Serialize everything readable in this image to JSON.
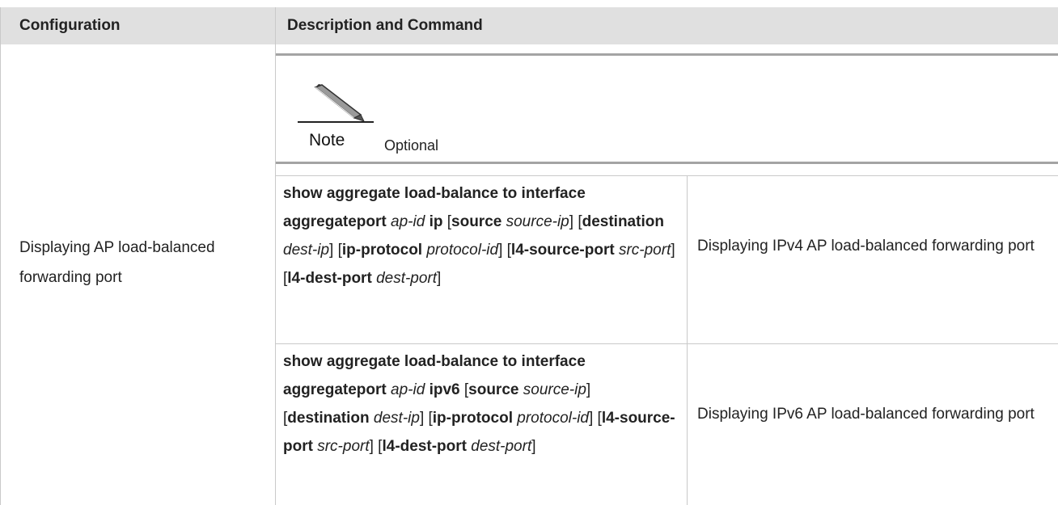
{
  "table": {
    "headers": {
      "configuration": "Configuration",
      "description": "Description and Command"
    },
    "row": {
      "configuration": "Displaying AP load-balanced forwarding port",
      "note": {
        "label": "Note",
        "text": "Optional",
        "icon": "pencil-icon"
      },
      "commands": [
        {
          "segments": [
            {
              "t": "show aggregate load-balance to interface aggregateport",
              "s": "b"
            },
            {
              "t": " ",
              "s": "n"
            },
            {
              "t": "ap-id",
              "s": "i"
            },
            {
              "t": " ",
              "s": "n"
            },
            {
              "t": "ip",
              "s": "b"
            },
            {
              "t": " [",
              "s": "n"
            },
            {
              "t": "source",
              "s": "b"
            },
            {
              "t": " ",
              "s": "n"
            },
            {
              "t": "source-ip",
              "s": "i"
            },
            {
              "t": "] [",
              "s": "n"
            },
            {
              "t": "destination",
              "s": "b"
            },
            {
              "t": " ",
              "s": "n"
            },
            {
              "t": "dest-ip",
              "s": "i"
            },
            {
              "t": "] [",
              "s": "n"
            },
            {
              "t": "ip-protocol",
              "s": "b"
            },
            {
              "t": " ",
              "s": "n"
            },
            {
              "t": "protocol-id",
              "s": "i"
            },
            {
              "t": "] [",
              "s": "n"
            },
            {
              "t": "l4-source-port",
              "s": "b"
            },
            {
              "t": " ",
              "s": "n"
            },
            {
              "t": "src-port",
              "s": "i"
            },
            {
              "t": "] [",
              "s": "n"
            },
            {
              "t": "l4-dest-port",
              "s": "b"
            },
            {
              "t": " ",
              "s": "n"
            },
            {
              "t": "dest-port",
              "s": "i"
            },
            {
              "t": "]",
              "s": "n"
            }
          ],
          "description": "Displaying IPv4 AP load-balanced forwarding port"
        },
        {
          "segments": [
            {
              "t": "show aggregate load-balance to interface aggregateport",
              "s": "b"
            },
            {
              "t": " ",
              "s": "n"
            },
            {
              "t": "ap-id",
              "s": "i"
            },
            {
              "t": " ",
              "s": "n"
            },
            {
              "t": "ipv6",
              "s": "b"
            },
            {
              "t": " [",
              "s": "n"
            },
            {
              "t": "source",
              "s": "b"
            },
            {
              "t": " ",
              "s": "n"
            },
            {
              "t": "source-ip",
              "s": "i"
            },
            {
              "t": "] [",
              "s": "n"
            },
            {
              "t": "destination",
              "s": "b"
            },
            {
              "t": " ",
              "s": "n"
            },
            {
              "t": "dest-ip",
              "s": "i"
            },
            {
              "t": "] [",
              "s": "n"
            },
            {
              "t": "ip-protocol",
              "s": "b"
            },
            {
              "t": " ",
              "s": "n"
            },
            {
              "t": "protocol-id",
              "s": "i"
            },
            {
              "t": "] [",
              "s": "n"
            },
            {
              "t": "l4-source-port",
              "s": "b"
            },
            {
              "t": " ",
              "s": "n"
            },
            {
              "t": "src-port",
              "s": "i"
            },
            {
              "t": "] [",
              "s": "n"
            },
            {
              "t": "l4-dest-port",
              "s": "b"
            },
            {
              "t": " ",
              "s": "n"
            },
            {
              "t": "dest-port",
              "s": "i"
            },
            {
              "t": "]",
              "s": "n"
            }
          ],
          "description": "Displaying IPv6 AP load-balanced forwarding port"
        }
      ]
    }
  }
}
